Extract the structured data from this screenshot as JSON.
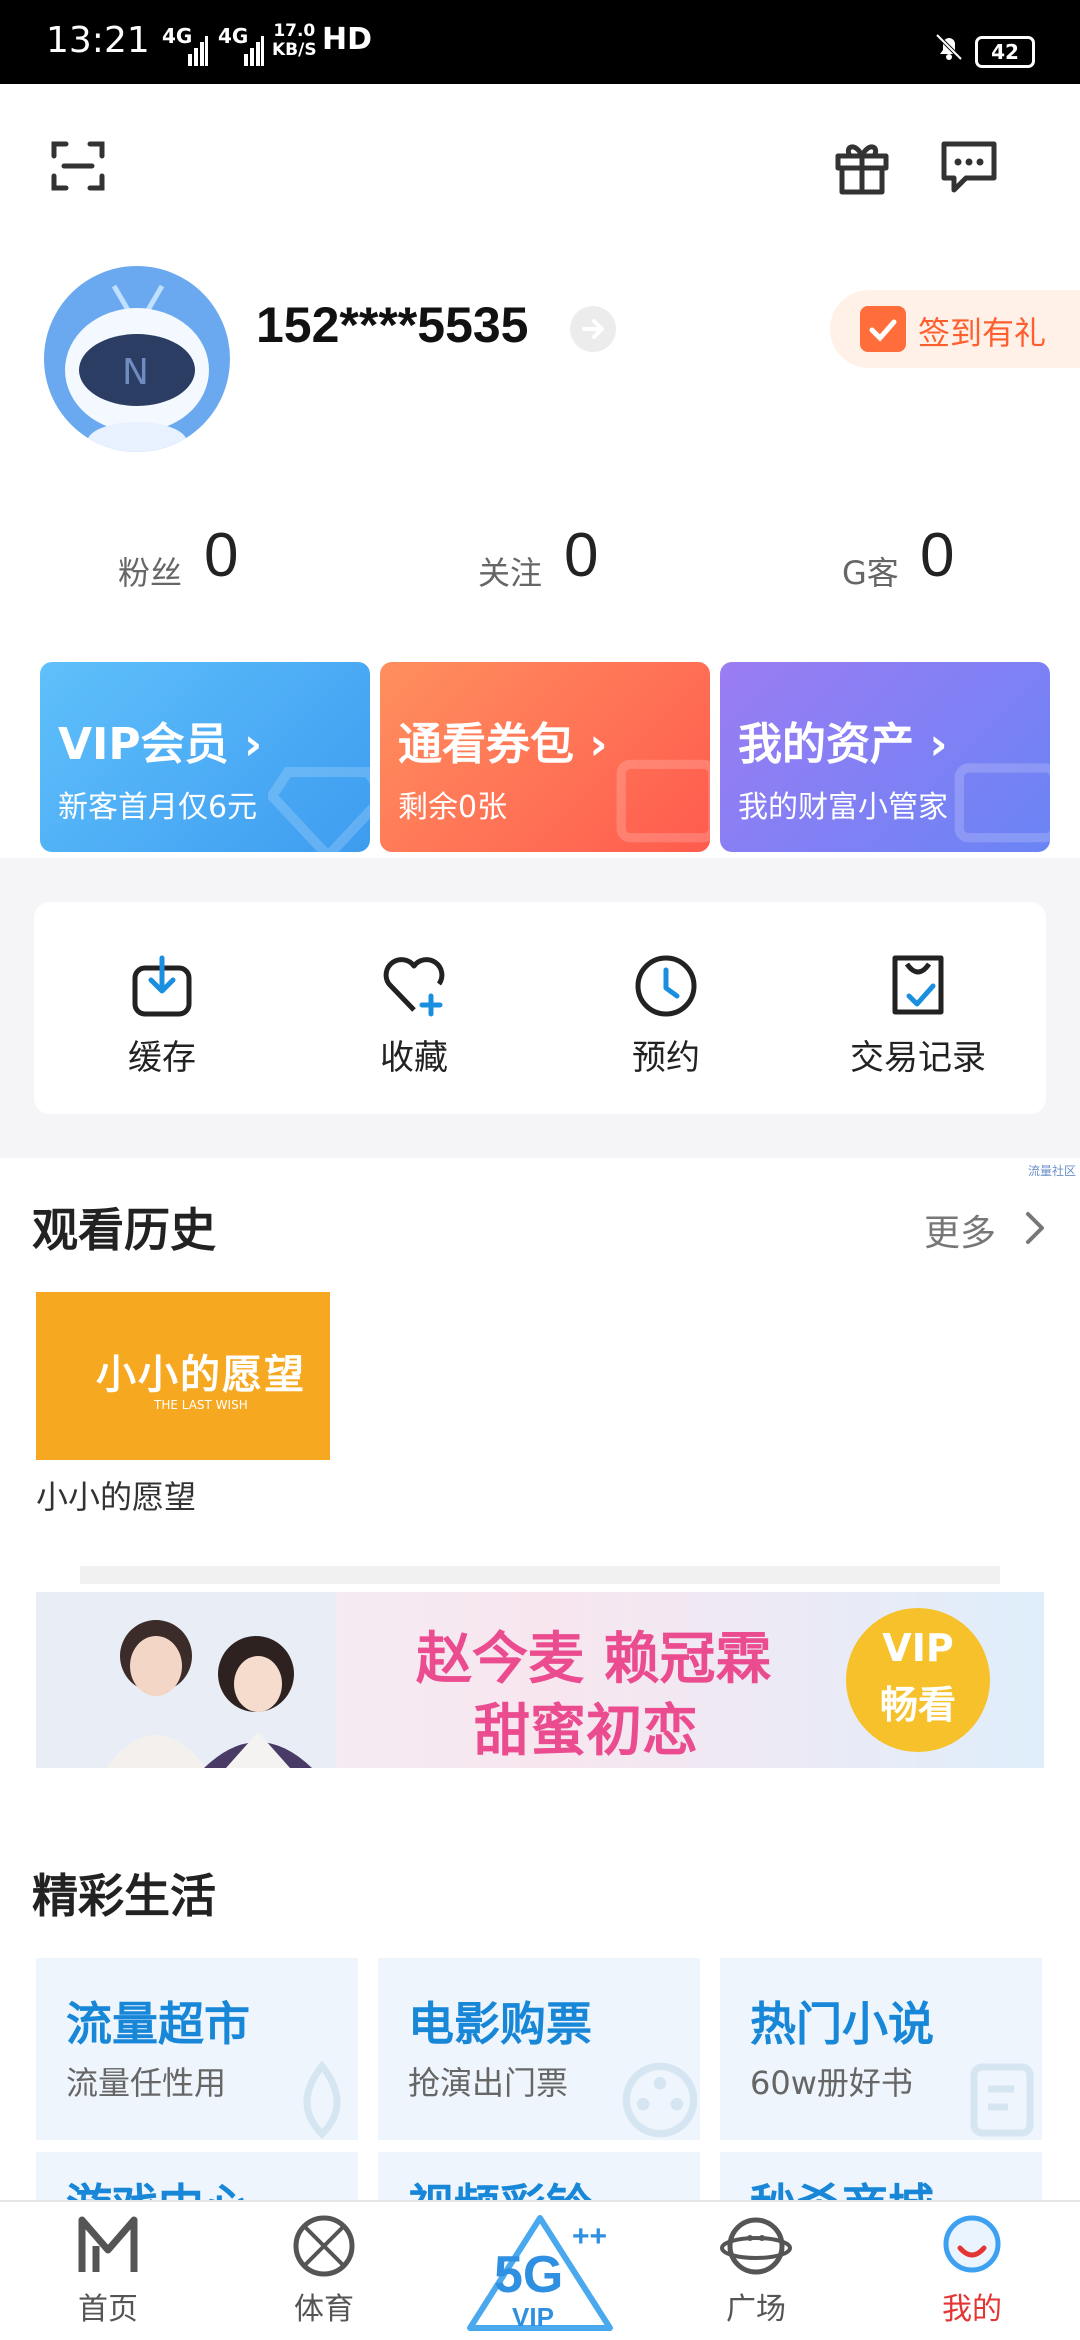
{
  "status_bar": {
    "time": "13:21",
    "signal_1": "4G",
    "signal_2": "4G",
    "speed_value": "17.0",
    "speed_unit": "KB/S",
    "hd": "HD",
    "battery": "42"
  },
  "profile": {
    "phone": "152****5535",
    "checkin_label": "签到有礼"
  },
  "stats": [
    {
      "label": "粉丝",
      "value": "0"
    },
    {
      "label": "关注",
      "value": "0"
    },
    {
      "label": "G客",
      "value": "0"
    }
  ],
  "cards": [
    {
      "title": "VIP会员 ›",
      "subtitle": "新客首月仅6元"
    },
    {
      "title": "通看券包 ›",
      "subtitle": "剩余0张"
    },
    {
      "title": "我的资产 ›",
      "subtitle": "我的财富小管家"
    }
  ],
  "tools": [
    {
      "label": "缓存",
      "icon": "download-icon"
    },
    {
      "label": "收藏",
      "icon": "heart-plus-icon"
    },
    {
      "label": "预约",
      "icon": "clock-icon"
    },
    {
      "label": "交易记录",
      "icon": "receipt-check-icon"
    }
  ],
  "corner_tag": "流量社区",
  "history": {
    "title": "观看历史",
    "more": "更多",
    "items": [
      {
        "title": "小小的愿望",
        "thumb_text": "小小的愿望",
        "thumb_sub": "THE LAST WISH"
      }
    ]
  },
  "banner": {
    "line1": "赵今麦 赖冠霖",
    "line2": "甜蜜初恋",
    "badge_1": "VIP",
    "badge_2": "畅看"
  },
  "life": {
    "title": "精彩生活",
    "items": [
      {
        "title": "流量超市",
        "subtitle": "流量任性用"
      },
      {
        "title": "电影购票",
        "subtitle": "抢演出门票"
      },
      {
        "title": "热门小说",
        "subtitle": "60w册好书"
      },
      {
        "title": "游戏中心",
        "subtitle": ""
      },
      {
        "title": "视频彩铃",
        "subtitle": ""
      },
      {
        "title": "秒杀商城",
        "subtitle": ""
      }
    ]
  },
  "tabbar": {
    "items": [
      {
        "label": "首页"
      },
      {
        "label": "体育"
      },
      {
        "label": "VIP"
      },
      {
        "label": "广场"
      },
      {
        "label": "我的"
      }
    ],
    "active_color": "#e43535"
  },
  "colors": {
    "accent_blue": "#1887d8",
    "vip_card": "#4fb0f5",
    "coupon_card": "#ff6a4f",
    "assets_card": "#7a7bf0",
    "checkin_orange": "#ff5f2f"
  }
}
